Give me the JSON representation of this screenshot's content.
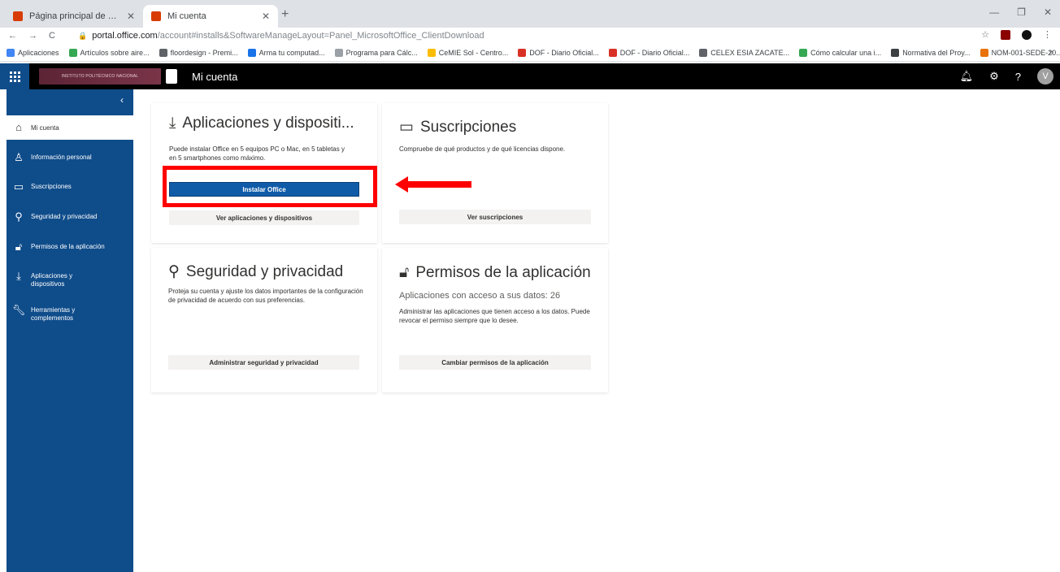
{
  "browser": {
    "tabs": [
      {
        "title": "Página principal de Microsoft Office",
        "active": false
      },
      {
        "title": "Mi cuenta",
        "active": true
      }
    ],
    "new_tab": "+",
    "url_host": "portal.office.com",
    "url_path": "/account#installs&SoftwareManageLayout=Panel_MicrosoftOffice_ClientDownload",
    "bookmarks": [
      "Aplicaciones",
      "Artículos sobre aire...",
      "floordesign - Premi...",
      "Arma tu computad...",
      "Programa para Cálc...",
      "CeMIE Sol - Centro...",
      "DOF - Diario Oficial...",
      "DOF - Diario Oficial...",
      "CELEX ESIA ZACATE...",
      "Cómo calcular una i...",
      "Normativa del Proy...",
      "NOM-001-SEDE-20..."
    ],
    "bookmarks_more": "»"
  },
  "header": {
    "title": "Mi cuenta",
    "logo_text": "INSTITUTO POLITÉCNICO NACIONAL",
    "avatar_initial": "V",
    "help": "?"
  },
  "sidebar": {
    "collapse": "‹",
    "items": [
      {
        "label": "Mi cuenta",
        "icon": "home-icon"
      },
      {
        "label": "Información personal",
        "icon": "person-icon"
      },
      {
        "label": "Suscripciones",
        "icon": "card-icon"
      },
      {
        "label": "Seguridad y privacidad",
        "icon": "key-icon"
      },
      {
        "label": "Permisos de la aplicación",
        "icon": "lock-icon"
      },
      {
        "label": "Aplicaciones y dispositivos",
        "icon": "download-icon"
      },
      {
        "label": "Herramientas y complementos",
        "icon": "wrench-icon"
      }
    ]
  },
  "cards": {
    "apps": {
      "title": "Aplicaciones y dispositi...",
      "desc": "Puede instalar Office en 5 equipos PC o Mac, en 5 tabletas y en 5 smartphones como máximo.",
      "primary_button": "Instalar Office",
      "secondary_button": "Ver aplicaciones y dispositivos"
    },
    "subs": {
      "title": "Suscripciones",
      "desc": "Compruebe de qué productos y de qué licencias dispone.",
      "button": "Ver suscripciones"
    },
    "security": {
      "title": "Seguridad y privacidad",
      "desc": "Proteja su cuenta y ajuste los datos importantes de la configuración de privacidad de acuerdo con sus preferencias.",
      "button": "Administrar seguridad y privacidad"
    },
    "permissions": {
      "title": "Permisos de la aplicación",
      "sub": "Aplicaciones con acceso a sus datos: 26",
      "desc": "Administrar las aplicaciones que tienen acceso a los datos. Puede revocar el permiso siempre que lo desee.",
      "button": "Cambiar permisos de la aplicación"
    }
  },
  "colors": {
    "accent": "#0f4c8a",
    "highlight": "#ff0000"
  }
}
